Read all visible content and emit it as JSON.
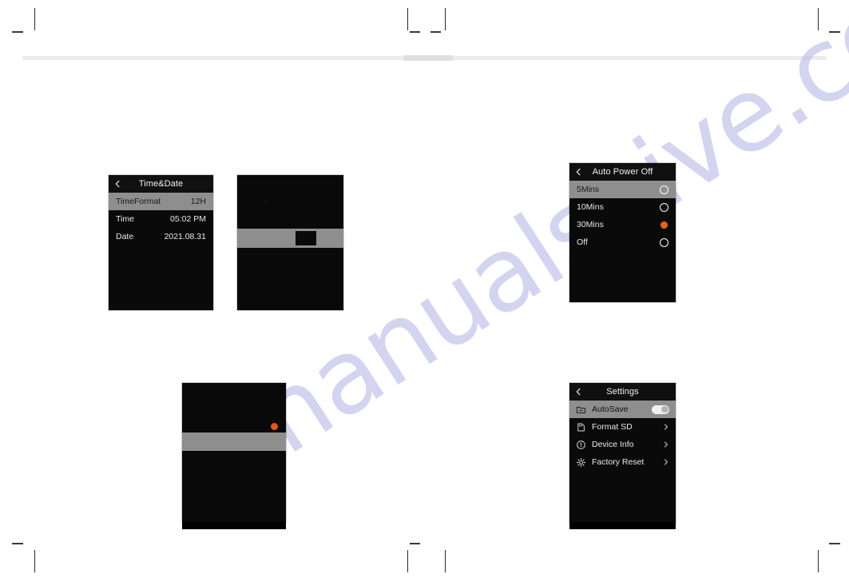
{
  "page": {
    "watermark": "manualshive.com"
  },
  "screens": {
    "time_date": {
      "title": "Time&Date",
      "back_icon": "back-chevron-icon",
      "rows": [
        {
          "label": "TimeFormat",
          "value": "12H",
          "selected": true
        },
        {
          "label": "Time",
          "value": "05:02  PM",
          "selected": false
        },
        {
          "label": "Date",
          "value": "2021.08.31",
          "selected": false
        }
      ]
    },
    "auto_power_off": {
      "title": "Auto Power Off",
      "back_icon": "back-chevron-icon",
      "options": [
        {
          "label": "5Mins",
          "selected_row": true,
          "checked": false
        },
        {
          "label": "10Mins",
          "selected_row": false,
          "checked": false
        },
        {
          "label": "30Mins",
          "selected_row": false,
          "checked": true
        },
        {
          "label": "Off",
          "selected_row": false,
          "checked": false
        }
      ],
      "accent_color": "#e8621a"
    },
    "settings": {
      "title": "Settings",
      "back_icon": "back-chevron-icon",
      "items": [
        {
          "label": "AutoSave",
          "icon": "folder-minus-icon",
          "control": "toggle",
          "toggle_on": true,
          "selected_row": true
        },
        {
          "label": "Format SD",
          "icon": "sd-card-icon",
          "control": "chevron",
          "selected_row": false
        },
        {
          "label": "Device Info",
          "icon": "info-circle-icon",
          "control": "chevron",
          "selected_row": false
        },
        {
          "label": "Factory Reset",
          "icon": "gear-icon",
          "control": "chevron",
          "selected_row": false
        }
      ]
    },
    "photo_top": {
      "name": "dark-preview-screen-top"
    },
    "photo_bottom": {
      "name": "dark-preview-screen-bottom"
    }
  }
}
